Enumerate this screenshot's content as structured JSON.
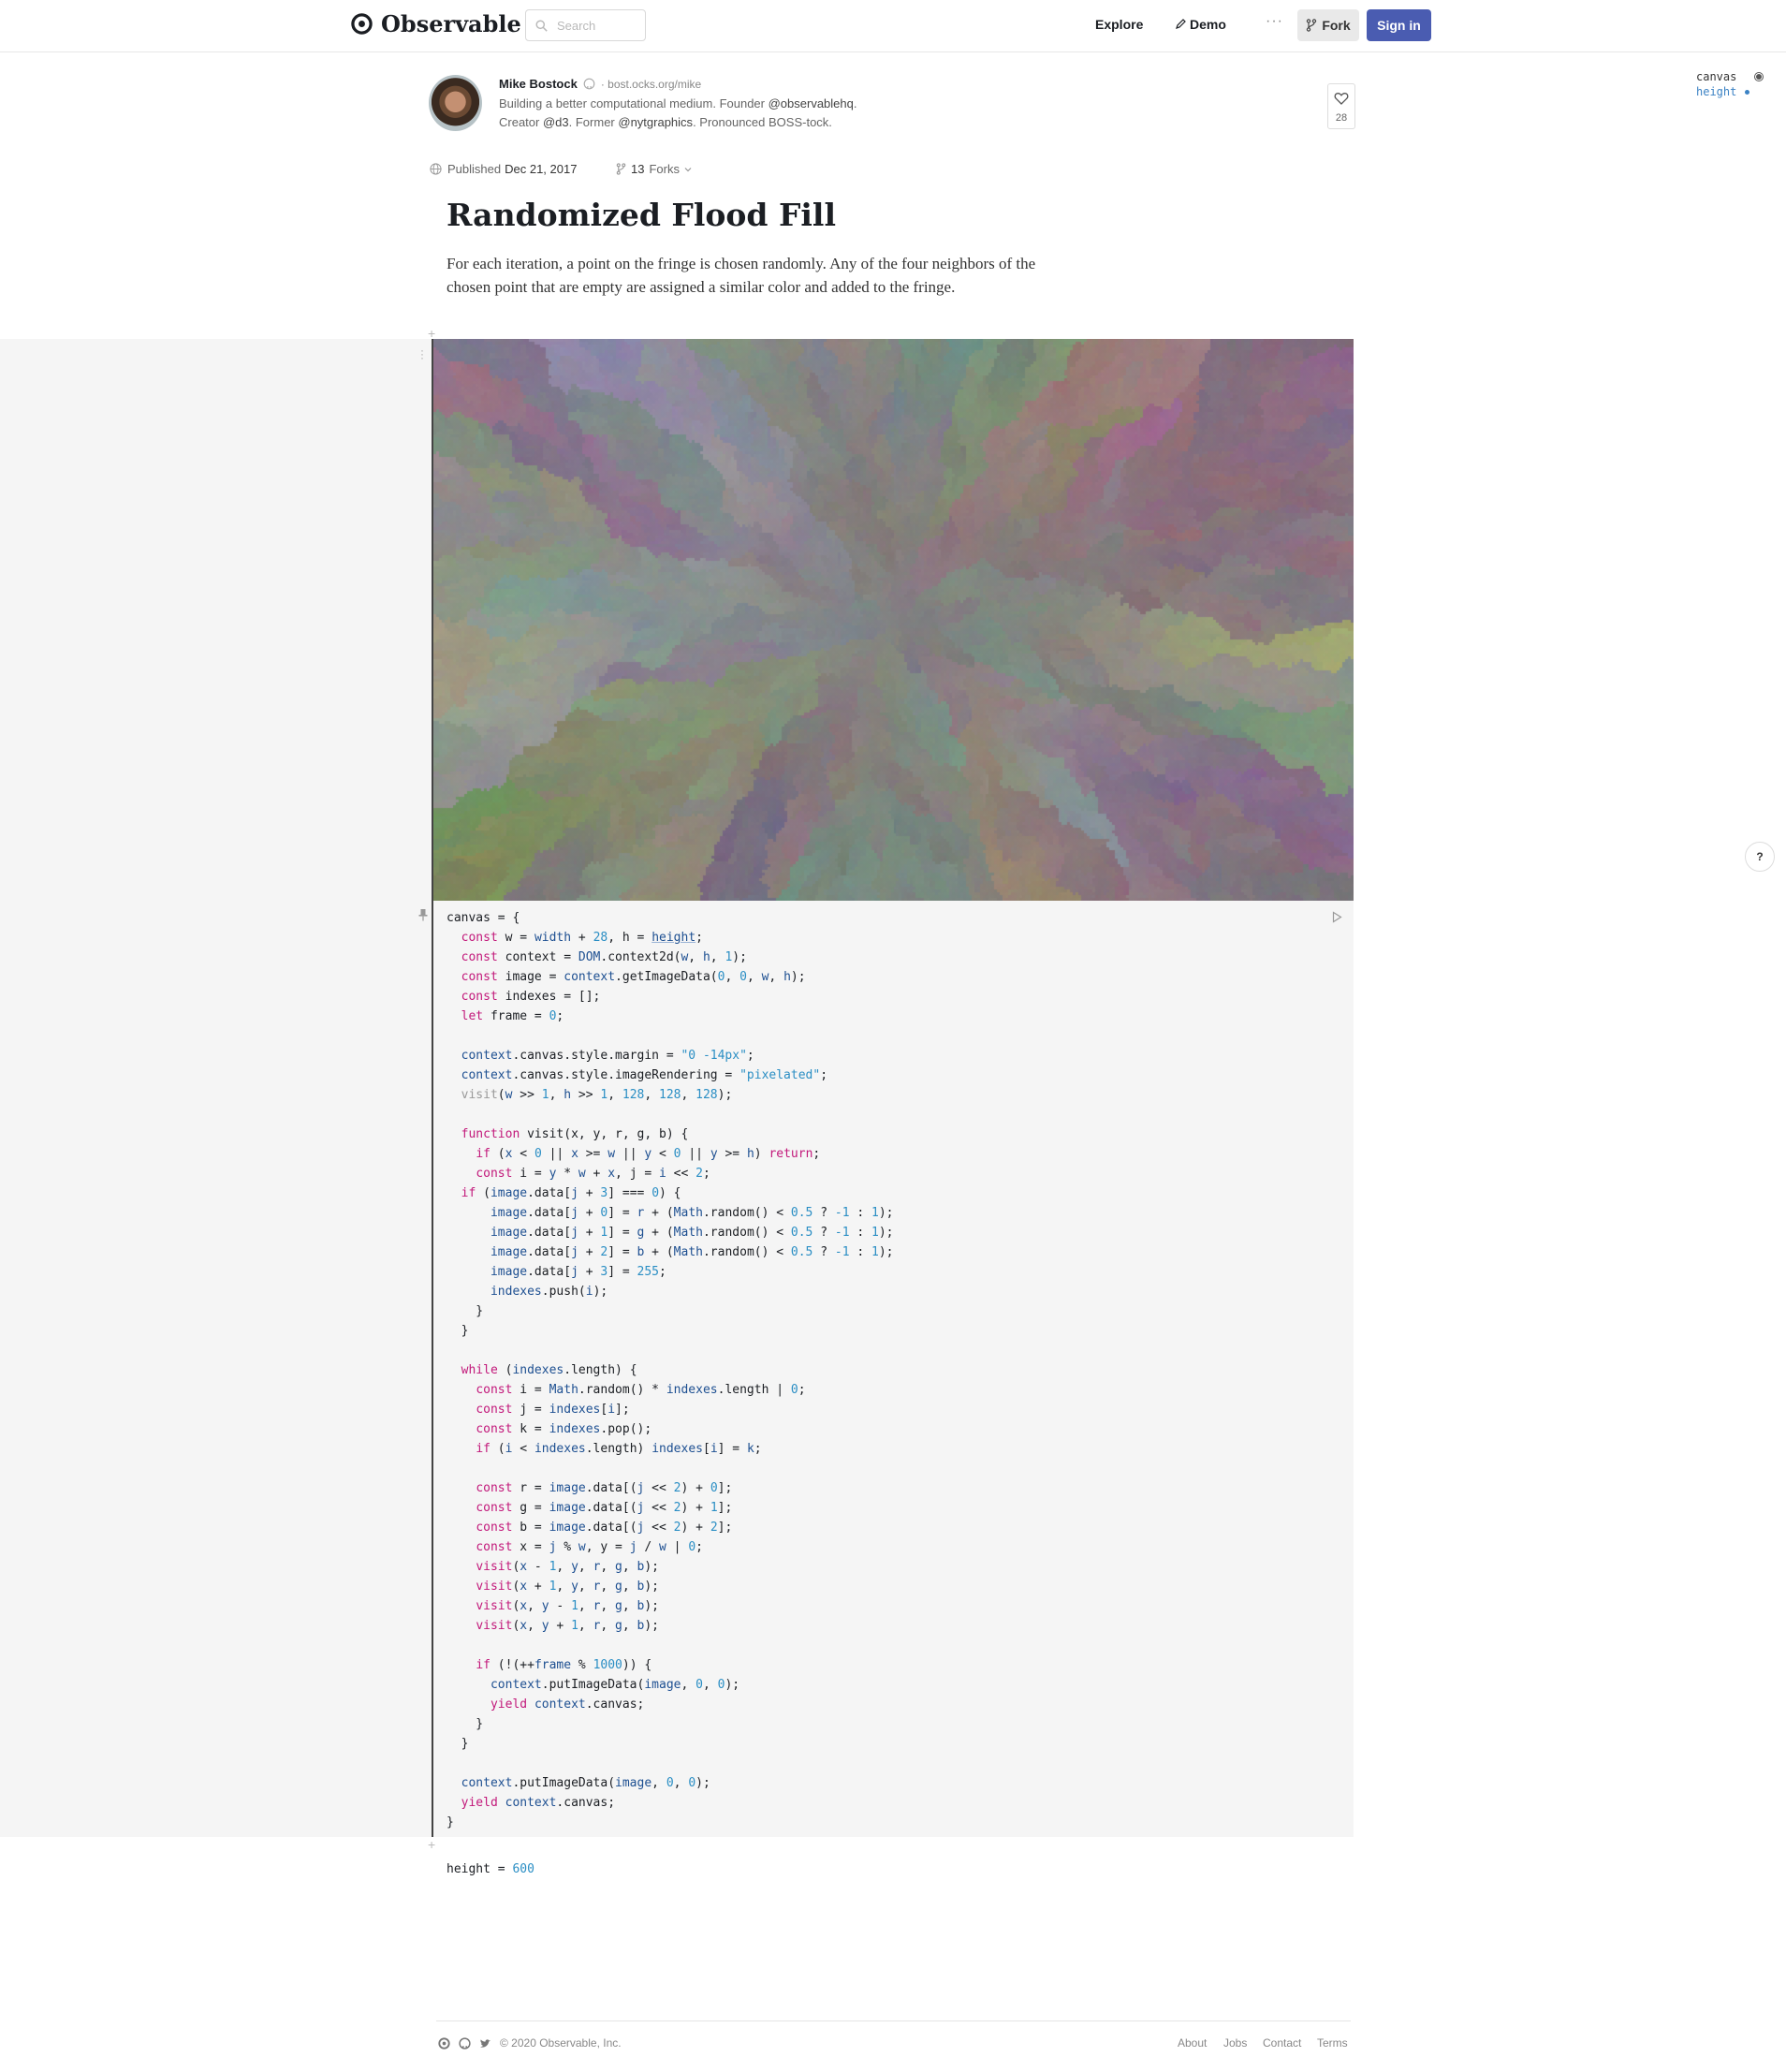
{
  "header": {
    "brand": "Observable",
    "search_placeholder": "Search",
    "explore": "Explore",
    "demo": "Demo",
    "more": "···",
    "fork": "Fork",
    "signin": "Sign in"
  },
  "author": {
    "name": "Mike Bostock",
    "site": "bost.ocks.org/mike",
    "bio_1a": "Building a better computational medium. Founder ",
    "bio_1b": "@observablehq",
    "bio_1c": ".",
    "bio_2a": "Creator ",
    "bio_2b": "@d3",
    "bio_2c": ". Former ",
    "bio_2d": "@nytgraphics",
    "bio_2e": ". Pronounced BOSS-tock."
  },
  "likes": "28",
  "meta": {
    "published_label": "Published",
    "published_date": "Dec 21, 2017",
    "forks_count": "13",
    "forks_label": "Forks"
  },
  "minimap": {
    "canvas": "canvas",
    "height": "height"
  },
  "help": "?",
  "article": {
    "title": "Randomized Flood Fill",
    "intro": "For each iteration, a point on the fringe is chosen randomly. Any of the four neighbors of the chosen point that are empty are assigned a similar color and added to the fringe."
  },
  "cells": {
    "height_name": "height = ",
    "height_value": "600"
  },
  "footer": {
    "copyright": "© 2020 Observable, Inc.",
    "about": "About",
    "jobs": "Jobs",
    "contact": "Contact",
    "terms": "Terms"
  },
  "colors": {
    "brand_button": "#4a5cb1",
    "keyword": "#c2187a",
    "number": "#2a8ec4",
    "variable": "#1d4f91",
    "cell_background": "#f5f5f5"
  }
}
